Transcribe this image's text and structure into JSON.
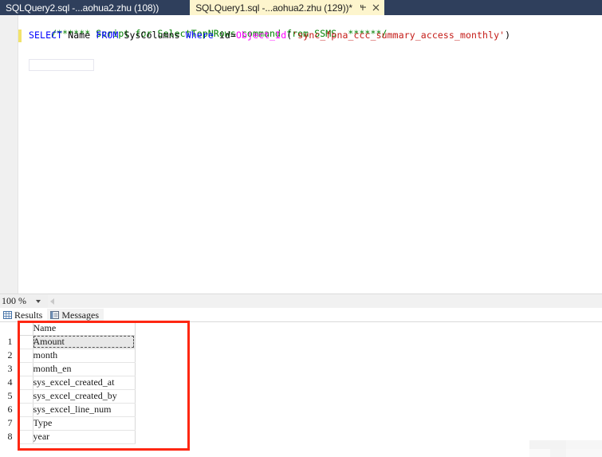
{
  "window": {
    "app": "SQL Server Management Studio",
    "tabs": [
      {
        "title": "SQLQuery2.sql -...aohua2.zhu (108))",
        "active": false,
        "dirty": false
      },
      {
        "title": "SQLQuery1.sql -...aohua2.zhu (129))*",
        "active": true,
        "dirty": true
      }
    ],
    "tab_icons": {
      "pin": "pin-icon",
      "close": "close-icon"
    }
  },
  "editor": {
    "line1": {
      "full": "/****** Script for SelectTopNRows command from SSMS  ******/",
      "comment": "/****** Script for SelectTopNRows command from SSMS  ******/"
    },
    "line2": {
      "kw_select": "SELECT",
      "col_name": "Name",
      "kw_from": "FROM",
      "table": "SysColumns",
      "kw_where": "Where",
      "pred_col": "id",
      "equals": "=",
      "func": "Object_Id",
      "paren_open": "(",
      "string": "'sync_fpna_ccc_summary_access_monthly'",
      "paren_close": ")"
    }
  },
  "status": {
    "zoom": "100 %",
    "zoom_caret": "chevron-down-icon"
  },
  "results_pane": {
    "tabs": [
      {
        "label": "Results",
        "icon": "grid-icon",
        "selected": true
      },
      {
        "label": "Messages",
        "icon": "message-icon",
        "selected": false
      }
    ],
    "grid": {
      "columns": [
        "Name"
      ],
      "rows": [
        {
          "num": "1",
          "name": "Amount",
          "selected": true
        },
        {
          "num": "2",
          "name": "month",
          "selected": false
        },
        {
          "num": "3",
          "name": "month_en",
          "selected": false
        },
        {
          "num": "4",
          "name": "sys_excel_created_at",
          "selected": false
        },
        {
          "num": "5",
          "name": "sys_excel_created_by",
          "selected": false
        },
        {
          "num": "6",
          "name": "sys_excel_line_num",
          "selected": false
        },
        {
          "num": "7",
          "name": "Type",
          "selected": false
        },
        {
          "num": "8",
          "name": "year",
          "selected": false
        }
      ]
    }
  },
  "annotation": {
    "shape": "rectangle",
    "color": "#fe2712"
  },
  "colors": {
    "tabstrip_bg": "#2f3f5c",
    "active_tab_bg": "#fdf5cd",
    "comment_green": "#008000",
    "keyword_blue": "#0000ff",
    "function_magenta": "#ff00ff",
    "string_red": "#c41a16",
    "change_bar_yellow": "#f2e36b",
    "annotation_red": "#fe2712"
  }
}
